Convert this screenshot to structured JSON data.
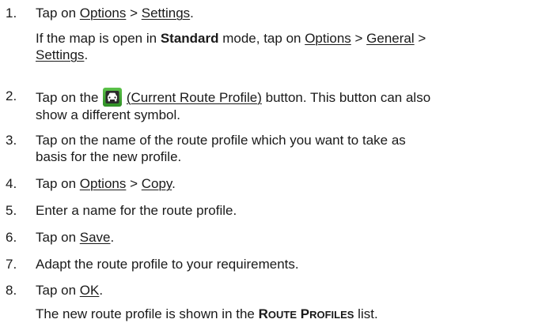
{
  "steps": [
    {
      "num": "1.",
      "pre": "Tap on ",
      "link1": "Options",
      "sep1": " > ",
      "link2": "Settings",
      "post": ".",
      "note": {
        "pre": "If the map is open in ",
        "bold": "Standard",
        "mid": " mode, tap on ",
        "link1": "Options",
        "sep1": " > ",
        "link2": "General",
        "sep2": " > ",
        "link3": "Settings",
        "post": "."
      }
    },
    {
      "num": "2.",
      "pre": "Tap on the ",
      "icon": "car-route-profile-icon",
      "space": " ",
      "link_open": "(",
      "link": "Current Route Profile",
      "link_close": ")",
      "post_line1": " button. This button can also",
      "post_line2": "show a different symbol."
    },
    {
      "num": "3.",
      "line1": "Tap on the name of the route profile which you want to take as",
      "line2": "basis for the new profile."
    },
    {
      "num": "4.",
      "pre": "Tap on ",
      "link1": "Options",
      "sep1": " > ",
      "link2": "Copy",
      "post": "."
    },
    {
      "num": "5.",
      "text": "Enter a name for the route profile."
    },
    {
      "num": "6.",
      "pre": "Tap on ",
      "link": "Save",
      "post": "."
    },
    {
      "num": "7.",
      "text": "Adapt the route profile to your requirements."
    },
    {
      "num": "8.",
      "pre": "Tap on ",
      "link": "OK",
      "post": ".",
      "note": {
        "pre": "The new route profile is shown in the ",
        "sc1_big": "R",
        "sc1_small": "OUTE",
        "space": " ",
        "sc2_big": "P",
        "sc2_small": "ROFILES",
        "post": " list."
      }
    }
  ],
  "colors": {
    "text": "#1a1a1a",
    "icon_green": "#3aa32f",
    "icon_dark": "#2b2b2b"
  }
}
